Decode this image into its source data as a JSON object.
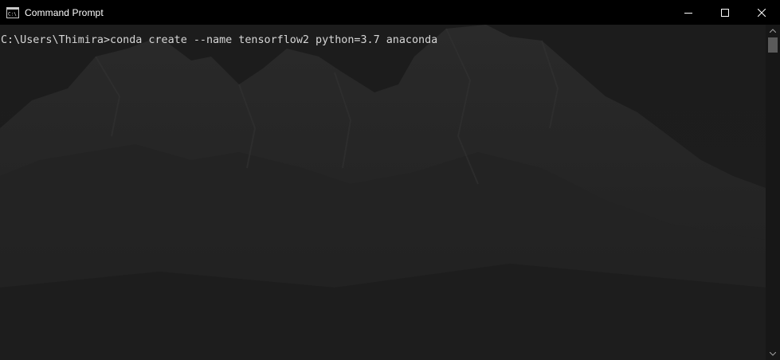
{
  "window": {
    "title": "Command Prompt",
    "app_icon": "cmd-icon",
    "controls": {
      "minimize": "minimize-icon",
      "maximize": "maximize-icon",
      "close": "close-icon"
    }
  },
  "console": {
    "lines": [
      "C:\\Users\\Thimira>conda create --name tensorflow2 python=3.7 anaconda"
    ],
    "text_color": "#d6d6d6",
    "background_color": "#1b1b1b"
  },
  "scrollbar": {
    "up_arrow": "scroll-up-icon",
    "down_arrow": "scroll-down-icon"
  }
}
